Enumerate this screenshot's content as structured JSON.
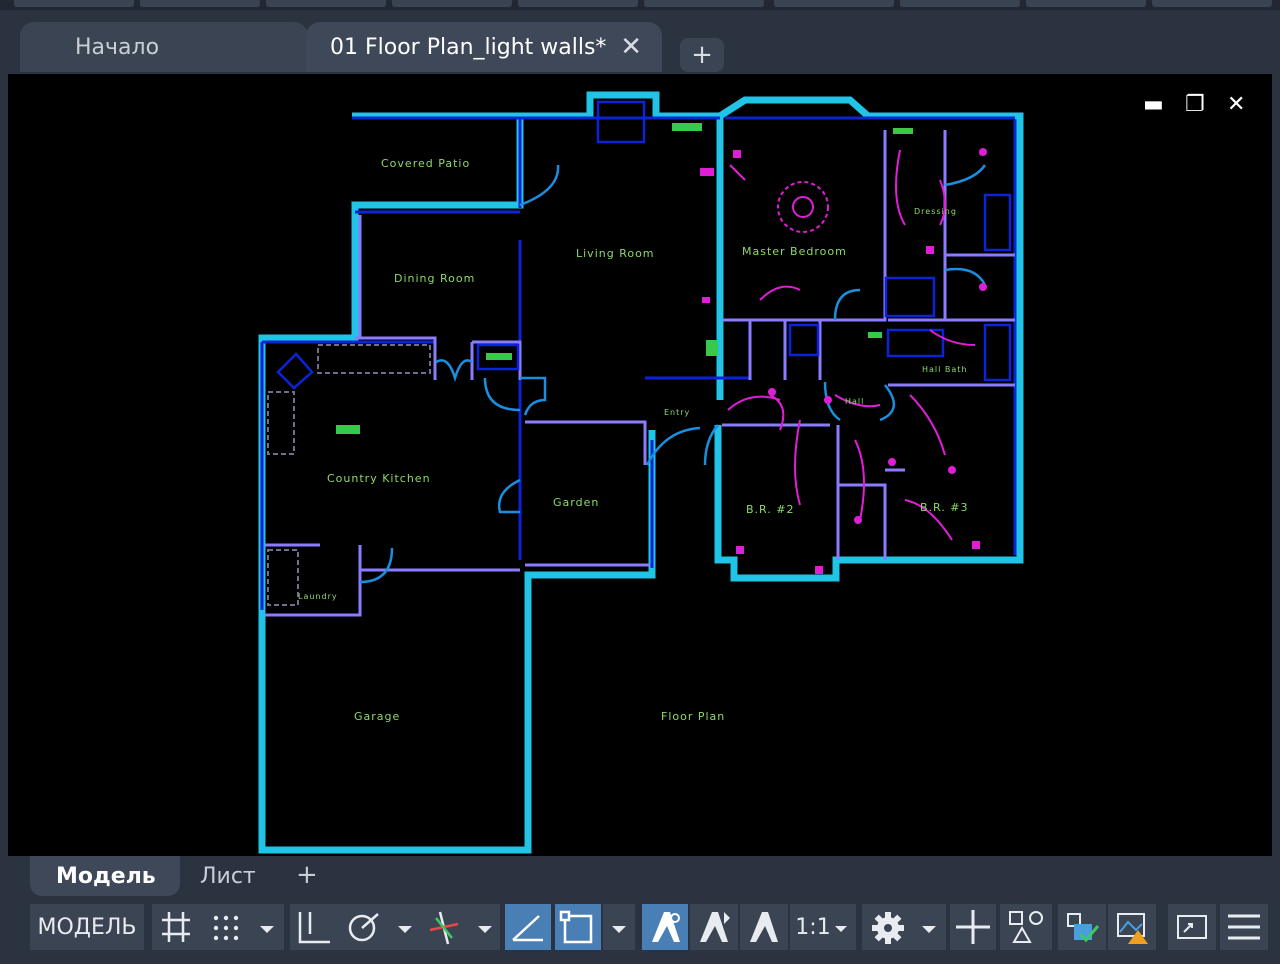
{
  "tabs": {
    "start_label": "Начало",
    "document_label": "01 Floor Plan_light walls*",
    "close_glyph": "✕",
    "add_glyph": "+"
  },
  "window_controls": {
    "minimize": "▬",
    "restore": "❐",
    "close": "✕"
  },
  "drawing": {
    "rooms": {
      "covered_patio": "Covered Patio",
      "living_room": "Living Room",
      "master_bedroom": "Master Bedroom",
      "dressing": "Dressing",
      "dining_room": "Dining Room",
      "hall_bath": "Hall Bath",
      "entry": "Entry",
      "hall": "Hall",
      "country_kitchen": "Country Kitchen",
      "garden": "Garden",
      "br2": "B.R. #2",
      "br3": "B.R. #3",
      "laundry": "Laundry",
      "garage": "Garage",
      "floor_plan": "Floor Plan"
    },
    "colors": {
      "background": "#000000",
      "wall_outline": "#1a8fe0",
      "wall_fill": "#1fc4e6",
      "interior": "#8a7bff",
      "electrical": "#e01ed8",
      "labels": "#8cd96a",
      "fixtures": "#0b24d8"
    }
  },
  "layout_tabs": {
    "model": "Модель",
    "sheet": "Лист",
    "add": "+"
  },
  "statusbar": {
    "model_label": "МОДЕЛЬ",
    "scale_label": "1:1",
    "icons": [
      "grid-icon",
      "snap-icon",
      "ortho-icon",
      "polar-icon",
      "isodraft-icon",
      "osnap-icon",
      "annotation-icon",
      "autoscale-icon",
      "annoscale-icon",
      "settings-icon",
      "crosshair-icon",
      "workspace-icon",
      "isolate-icon",
      "hardware-icon",
      "fullscreen-icon",
      "menu-icon"
    ]
  }
}
